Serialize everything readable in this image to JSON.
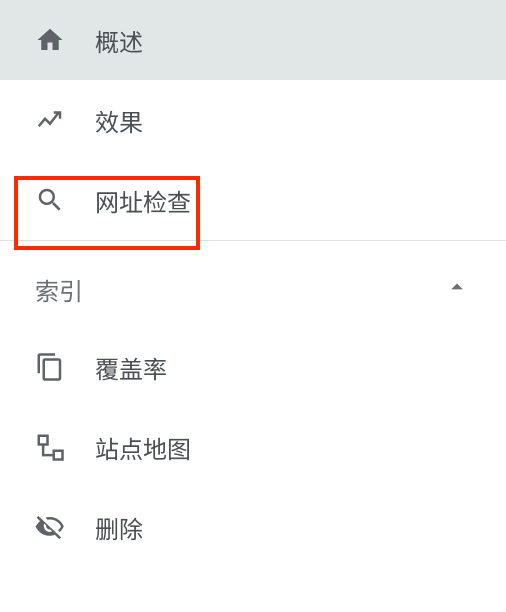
{
  "nav": {
    "items": [
      {
        "icon": "home-icon",
        "label": "概述",
        "selected": true
      },
      {
        "icon": "trend-icon",
        "label": "效果",
        "selected": false
      },
      {
        "icon": "search-icon",
        "label": "网址检查",
        "selected": false,
        "highlighted": true
      }
    ]
  },
  "section": {
    "label": "索引",
    "expanded": true,
    "items": [
      {
        "icon": "copy-icon",
        "label": "覆盖率"
      },
      {
        "icon": "sitemap-icon",
        "label": "站点地图"
      },
      {
        "icon": "visibility-off-icon",
        "label": "删除"
      }
    ]
  }
}
